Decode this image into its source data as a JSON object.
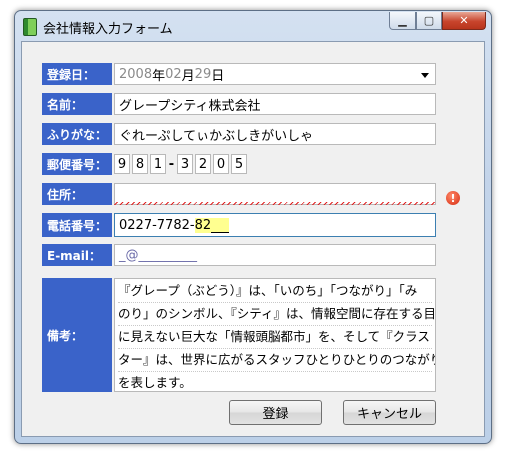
{
  "window": {
    "title": "会社情報入力フォーム"
  },
  "form": {
    "labels": {
      "date": "登録日：",
      "name": "名前：",
      "furigana": "ふりがな：",
      "zip": "郵便番号：",
      "address": "住所：",
      "phone": "電話番号：",
      "email": "E-mail：",
      "memo": "備考："
    },
    "date": {
      "year": "2008",
      "y_suffix": "年",
      "month": "02",
      "m_suffix": "月",
      "day": "29",
      "d_suffix": "日"
    },
    "name_value": "グレープシティ株式会社",
    "furigana_value": "ぐれーぷしてぃかぶしきがいしゃ",
    "zip": {
      "d1": "9",
      "d2": "8",
      "d3": "1",
      "dash": "-",
      "d4": "3",
      "d5": "2",
      "d6": "0",
      "d7": "5"
    },
    "address_value": "",
    "phone": {
      "prefix": "0227-7782-",
      "highlighted": "82"
    },
    "email": {
      "placeholder": "_@_________"
    },
    "memo_lines": [
      "『グレープ（ぶどう）』は、「いのち」「つながり」「み",
      "のり」のシンボル、『シティ』は、情報空間に存在する目",
      "に見えない巨大な「情報頭脳都市」を、そして『クラス",
      "ター』は、世界に広がるスタッフひとりひとりのつながり",
      "を表します。"
    ]
  },
  "buttons": {
    "register": "登録",
    "cancel": "キャンセル"
  },
  "icons": {
    "app": "green-book-icon",
    "error": "error-icon",
    "dropdown": "chevron-down-icon"
  }
}
